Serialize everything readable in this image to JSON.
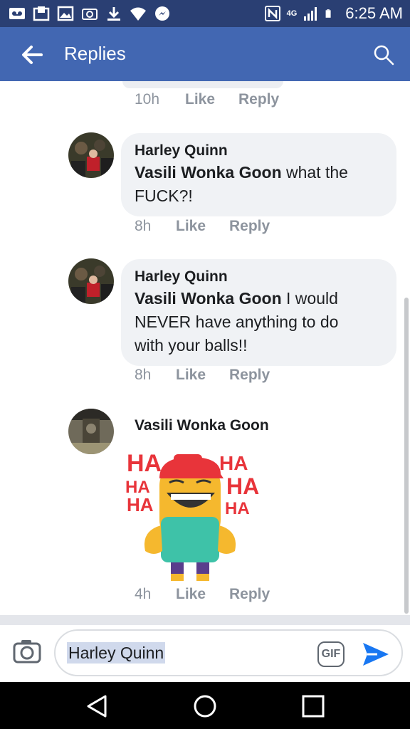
{
  "status_bar": {
    "time": "6:25 AM",
    "network_label": "4G"
  },
  "header": {
    "title": "Replies"
  },
  "previous_comment": {
    "time": "10h",
    "like_label": "Like",
    "reply_label": "Reply"
  },
  "comments": [
    {
      "author": "Harley Quinn",
      "mention": "Vasili Wonka Goon",
      "text_line1": " what the",
      "text_line2": "FUCK?!",
      "time": "8h",
      "like_label": "Like",
      "reply_label": "Reply"
    },
    {
      "author": "Harley Quinn",
      "mention": "Vasili Wonka Goon",
      "text_line1": " I would",
      "text_line2": "NEVER have anything to do",
      "text_line3": "with your balls!!",
      "time": "8h",
      "like_label": "Like",
      "reply_label": "Reply"
    },
    {
      "author": "Vasili Wonka Goon",
      "sticker_icon": "laughing-monster-sticker",
      "sticker_text": "HA",
      "time": "4h",
      "like_label": "Like",
      "reply_label": "Reply"
    }
  ],
  "composer": {
    "value": "Harley Quinn",
    "gif_label": "GIF"
  },
  "colors": {
    "status_bar": "#2a3f73",
    "app_bar": "#4267b2",
    "bubble": "#f0f2f5",
    "action_text": "#8d949e",
    "send": "#1877f2"
  }
}
